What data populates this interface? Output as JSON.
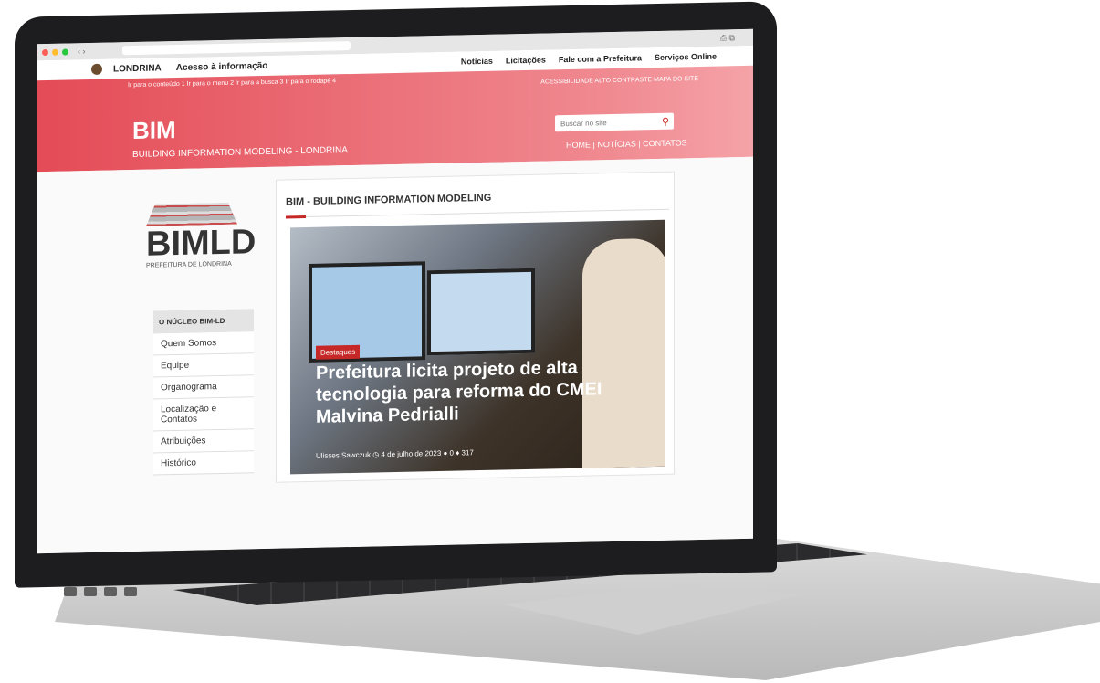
{
  "browser": {
    "nav_arrows": "‹ ›",
    "toolbar_icons": "⎙ ⧉"
  },
  "govbar": {
    "city": "LONDRINA",
    "access_info": "Acesso à informação",
    "links": [
      "Notícias",
      "Licitações",
      "Fale com a Prefeitura",
      "Serviços Online"
    ]
  },
  "header": {
    "skip_links": "Ir para o conteúdo 1  Ir para o menu 2  Ir para a busca 3  Ir para o rodapé 4",
    "accessibility_links": "ACESSIBILIDADE   ALTO CONTRASTE   MAPA DO SITE",
    "title": "BIM",
    "subtitle": "BUILDING INFORMATION MODELING - LONDRINA",
    "search_placeholder": "Buscar no site",
    "top_links": "HOME | NOTÍCIAS | CONTATOS"
  },
  "logo": {
    "text": "BIMLD",
    "subtext": "PREFEITURA DE LONDRINA"
  },
  "sidebar": {
    "heading": "O NÚCLEO BIM-LD",
    "items": [
      {
        "label": "Quem Somos"
      },
      {
        "label": "Equipe"
      },
      {
        "label": "Organograma"
      },
      {
        "label": "Localização e Contatos"
      },
      {
        "label": "Atribuições"
      },
      {
        "label": "Histórico"
      }
    ]
  },
  "main": {
    "section_title": "BIM - BUILDING INFORMATION MODELING",
    "feature": {
      "category": "Destaques",
      "headline": "Prefeitura licita projeto de alta tecnologia para reforma do CMEI Malvina Pedrialli",
      "meta": "Ulisses Sawczuk  ◷ 4 de julho de 2023  ● 0  ♦ 317"
    }
  },
  "colors": {
    "brand": "#e44b56",
    "accent": "#c62828"
  }
}
